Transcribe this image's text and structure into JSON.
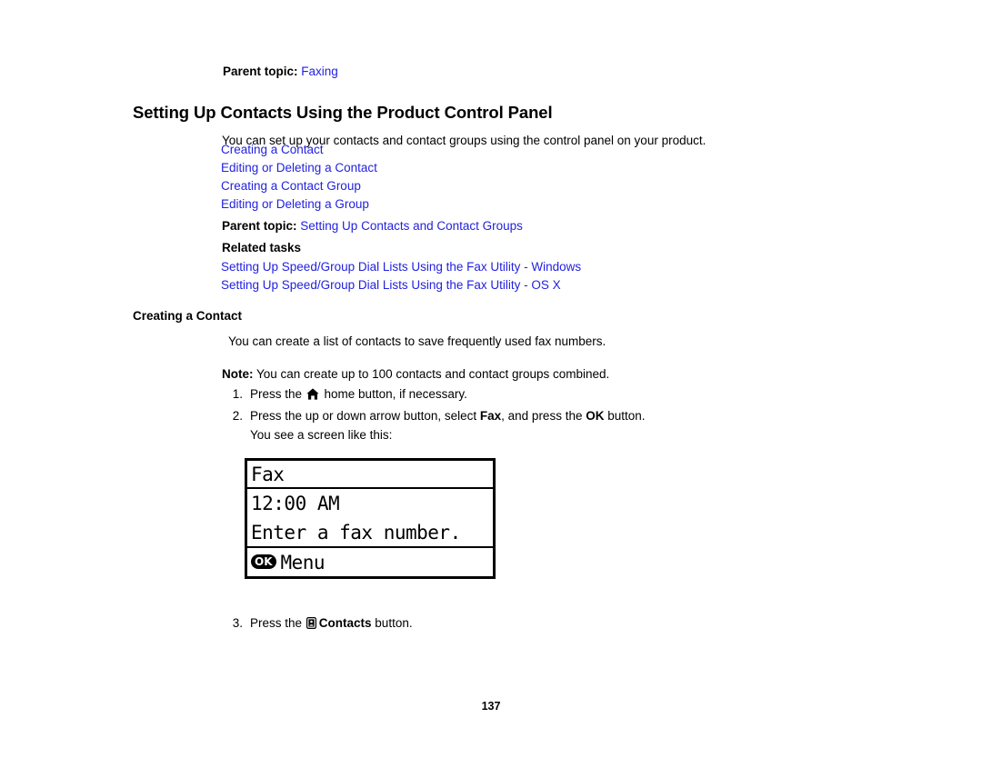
{
  "document": {
    "page_number": "137"
  },
  "parent_topic_top": {
    "label": "Parent topic:",
    "link": "Faxing"
  },
  "title": "Setting Up Contacts Using the Product Control Panel",
  "intro": "You can set up your contacts and contact groups using the control panel on your product.",
  "toc_links": [
    "Creating a Contact",
    "Editing or Deleting a Contact",
    "Creating a Contact Group",
    "Editing or Deleting a Group"
  ],
  "parent_topic_bottom": {
    "label": "Parent topic:",
    "link": "Setting Up Contacts and Contact Groups"
  },
  "related": {
    "heading": "Related tasks",
    "links": [
      "Setting Up Speed/Group Dial Lists Using the Fax Utility - Windows",
      "Setting Up Speed/Group Dial Lists Using the Fax Utility - OS X"
    ]
  },
  "section": {
    "heading": "Creating a Contact",
    "paragraph": "You can create a list of contacts to save frequently used fax numbers.",
    "note_label": "Note:",
    "note_text": " You can create up to 100 contacts and contact groups combined."
  },
  "steps": {
    "step1": {
      "number": "1.",
      "text_before": "Press the ",
      "icon": "home-icon",
      "text_after": " home button, if necessary."
    },
    "step2": {
      "number": "2.",
      "text_before": "Press the up or down arrow button, select ",
      "bold1": "Fax",
      "text_middle": ", and press the ",
      "bold2": "OK",
      "text_after": " button.",
      "substep": "You see a screen like this:"
    },
    "step3": {
      "number": "3.",
      "text_before": "Press the ",
      "icon": "contacts-icon",
      "bold1": "Contacts",
      "text_after": " button."
    }
  },
  "lcd_screen": {
    "title": "Fax",
    "time": "12:00 AM",
    "message": "Enter a fax number.",
    "ok_badge": "OK",
    "menu_label": "Menu"
  },
  "colors": {
    "link": "#2222e0",
    "text": "#000000",
    "background": "#ffffff"
  }
}
